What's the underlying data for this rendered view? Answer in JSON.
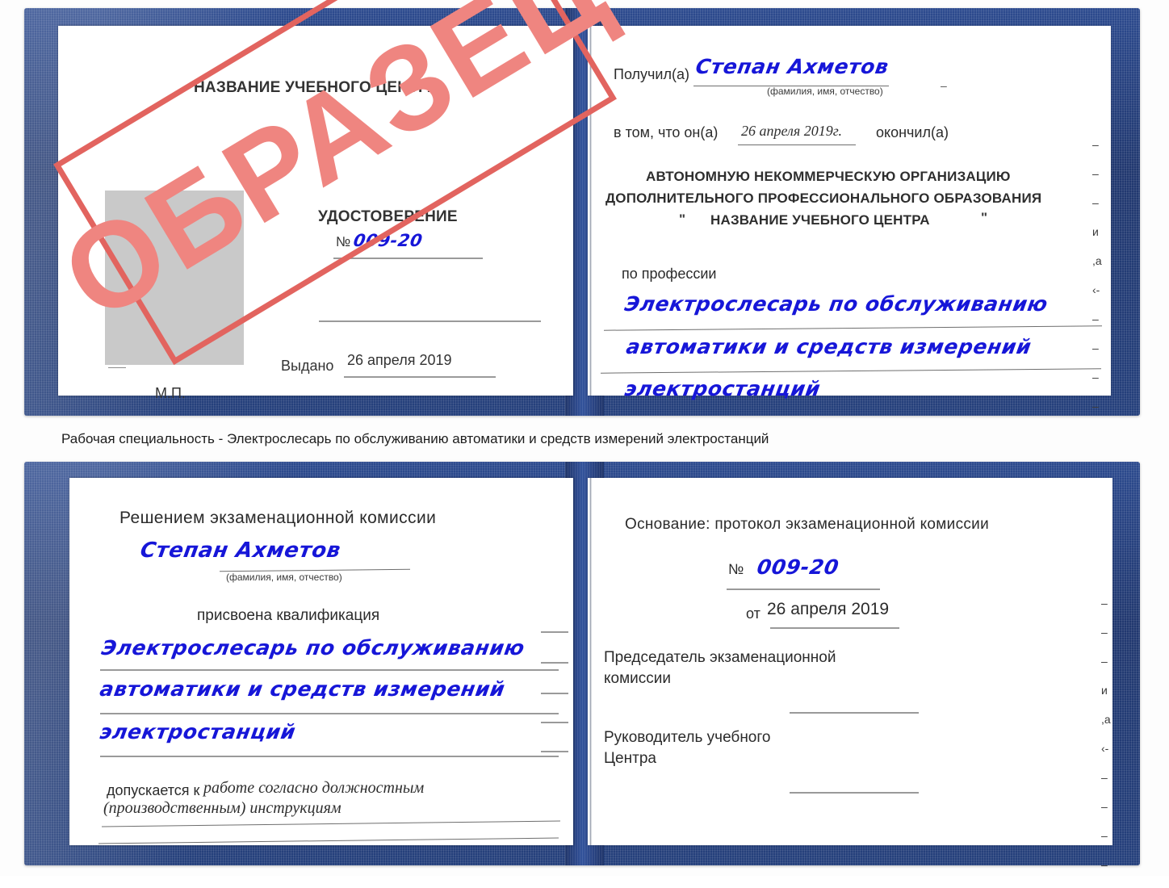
{
  "doc": {
    "type": "certificate-udostoverenie",
    "stamp_label": "ОБРАЗЕЦ",
    "accent_blue": "#25407c",
    "stamp_red": "#e2645f",
    "ink_blue": "#1616d8"
  },
  "top_certificate": {
    "left_page": {
      "center_name": "НАЗВАНИЕ УЧЕБНОГО ЦЕНТРА",
      "title": "УДОСТОВЕРЕНИЕ",
      "number_label": "№",
      "number_value": "009-20",
      "issued_label": "Выдано",
      "issued_value": "26 апреля 2019",
      "seal_label": "М.П."
    },
    "right_page": {
      "received_label": "Получил(а)",
      "received_value": "Степан Ахметов",
      "fio_hint": "(фамилия, имя, отчество)",
      "in_that_label": "в том, что он(а)",
      "finish_date": "26 апреля 2019г.",
      "finished_label": "окончил(а)",
      "org_line1": "АВТОНОМНУЮ НЕКОММЕРЧЕСКУЮ ОРГАНИЗАЦИЮ",
      "org_line2": "ДОПОЛНИТЕЛЬНОГО ПРОФЕССИОНАЛЬНОГО ОБРАЗОВАНИЯ",
      "org_quote_open": "\"",
      "org_line3": "НАЗВАНИЕ УЧЕБНОГО ЦЕНТРА",
      "org_quote_close": "\"",
      "profession_label": "по профессии",
      "profession_line1": "Электрослесарь по обслуживанию",
      "profession_line2": "автоматики и средств измерений",
      "profession_line3": "электростанций",
      "edge_glyphs": [
        "–",
        "–",
        "–",
        "и",
        ",а",
        "‹-",
        "–",
        "–",
        "–",
        "–"
      ]
    }
  },
  "caption": "Рабочая специальность - Электрослесарь по обслуживанию автоматики и средств измерений электростанций",
  "bottom_certificate": {
    "left_page": {
      "heading": "Решением экзаменационной комиссии",
      "name_value": "Степан Ахметов",
      "fio_hint": "(фамилия, имя, отчество)",
      "qualification_label": "присвоена квалификация",
      "qualification_line1": "Электрослесарь по обслуживанию",
      "qualification_line2": "автоматики и средств измерений",
      "qualification_line3": "электростанций",
      "allowed_label": "допускается к",
      "allowed_value1": "работе согласно должностным",
      "allowed_value2": "(производственным) инструкциям"
    },
    "right_page": {
      "basis_label": "Основание: протокол экзаменационной комиссии",
      "number_label": "№",
      "number_value": "009-20",
      "date_label": "от",
      "date_value": "26 апреля 2019",
      "chairman_line1": "Председатель экзаменационной",
      "chairman_line2": "комиссии",
      "head_line1": "Руководитель учебного",
      "head_line2": "Центра",
      "edge_glyphs": [
        "–",
        "–",
        "–",
        "и",
        ",а",
        "‹-",
        "–",
        "–",
        "–",
        "–"
      ]
    }
  }
}
